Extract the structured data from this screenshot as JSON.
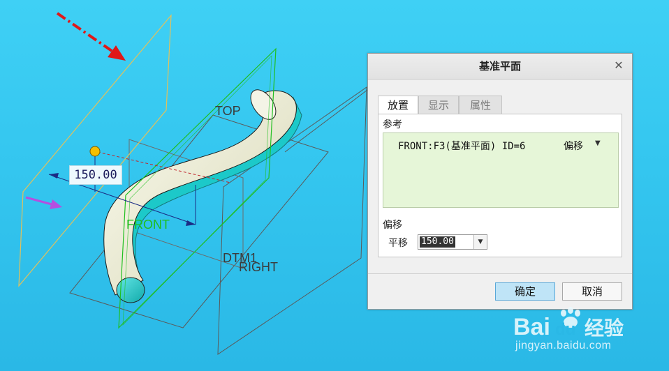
{
  "viewport": {
    "labels": {
      "top": "TOP",
      "front": "FRONT",
      "dtm1": "DTM1",
      "right": "RIGHT"
    },
    "dimension_value": "150.00",
    "colors": {
      "background": "#34c6ef",
      "datum_front": "#1fbf1f",
      "new_plane": "#e3c15a",
      "pipe_body": "#eeeed8",
      "pipe_inner": "#1cc9c9",
      "annotation_arrow": "#e01818",
      "direction_arrow": "#b44fe0"
    }
  },
  "dialog": {
    "title": "基准平面",
    "close_icon": "close-icon",
    "tabs": [
      {
        "label": "放置",
        "active": true
      },
      {
        "label": "显示",
        "active": false
      },
      {
        "label": "属性",
        "active": false
      }
    ],
    "references_label": "参考",
    "reference": {
      "text": "FRONT:F3(基准平面) ID=6",
      "mode": "偏移"
    },
    "offset_label": "偏移",
    "translation_label": "平移",
    "translation_value": "150.00",
    "ok_label": "确定",
    "cancel_label": "取消"
  },
  "watermark": {
    "brand": "Baidu经验",
    "url": "jingyan.baidu.com"
  }
}
